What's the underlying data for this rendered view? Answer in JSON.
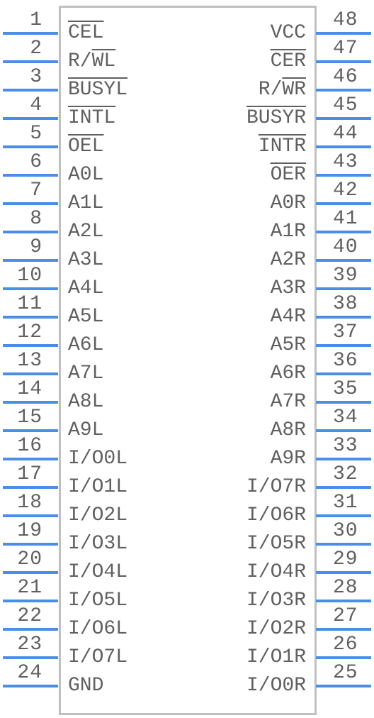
{
  "component": {
    "type": "schematic-symbol",
    "pin_count": 48,
    "colors": {
      "pin": "#4a8ee8",
      "outline": "#c0c0c0",
      "text": "#606060"
    }
  },
  "left_pins": [
    {
      "num": "1",
      "label": "CEL",
      "overline": [
        0,
        3
      ]
    },
    {
      "num": "2",
      "label": "R/WL",
      "overline": [
        2,
        4
      ]
    },
    {
      "num": "3",
      "label": "BUSYL",
      "overline": [
        0,
        5
      ]
    },
    {
      "num": "4",
      "label": "INTL",
      "overline": [
        0,
        4
      ]
    },
    {
      "num": "5",
      "label": "OEL",
      "overline": [
        0,
        3
      ]
    },
    {
      "num": "6",
      "label": "A0L"
    },
    {
      "num": "7",
      "label": "A1L"
    },
    {
      "num": "8",
      "label": "A2L"
    },
    {
      "num": "9",
      "label": "A3L"
    },
    {
      "num": "10",
      "label": "A4L"
    },
    {
      "num": "11",
      "label": "A5L"
    },
    {
      "num": "12",
      "label": "A6L"
    },
    {
      "num": "13",
      "label": "A7L"
    },
    {
      "num": "14",
      "label": "A8L"
    },
    {
      "num": "15",
      "label": "A9L"
    },
    {
      "num": "16",
      "label": "I/O0L"
    },
    {
      "num": "17",
      "label": "I/O1L"
    },
    {
      "num": "18",
      "label": "I/O2L"
    },
    {
      "num": "19",
      "label": "I/O3L"
    },
    {
      "num": "20",
      "label": "I/O4L"
    },
    {
      "num": "21",
      "label": "I/O5L"
    },
    {
      "num": "22",
      "label": "I/O6L"
    },
    {
      "num": "23",
      "label": "I/O7L"
    },
    {
      "num": "24",
      "label": "GND"
    }
  ],
  "right_pins": [
    {
      "num": "48",
      "label": "VCC"
    },
    {
      "num": "47",
      "label": "CER",
      "overline": [
        0,
        3
      ]
    },
    {
      "num": "46",
      "label": "R/WR",
      "overline": [
        2,
        4
      ]
    },
    {
      "num": "45",
      "label": "BUSYR",
      "overline": [
        0,
        5
      ]
    },
    {
      "num": "44",
      "label": "INTR",
      "overline": [
        0,
        4
      ]
    },
    {
      "num": "43",
      "label": "OER",
      "overline": [
        0,
        3
      ]
    },
    {
      "num": "42",
      "label": "A0R"
    },
    {
      "num": "41",
      "label": "A1R"
    },
    {
      "num": "40",
      "label": "A2R"
    },
    {
      "num": "39",
      "label": "A3R"
    },
    {
      "num": "38",
      "label": "A4R"
    },
    {
      "num": "37",
      "label": "A5R"
    },
    {
      "num": "36",
      "label": "A6R"
    },
    {
      "num": "35",
      "label": "A7R"
    },
    {
      "num": "34",
      "label": "A8R"
    },
    {
      "num": "33",
      "label": "A9R"
    },
    {
      "num": "32",
      "label": "I/O7R"
    },
    {
      "num": "31",
      "label": "I/O6R"
    },
    {
      "num": "30",
      "label": "I/O5R"
    },
    {
      "num": "29",
      "label": "I/O4R"
    },
    {
      "num": "28",
      "label": "I/O3R"
    },
    {
      "num": "27",
      "label": "I/O2R"
    },
    {
      "num": "26",
      "label": "I/O1R"
    },
    {
      "num": "25",
      "label": "I/O0R"
    }
  ]
}
